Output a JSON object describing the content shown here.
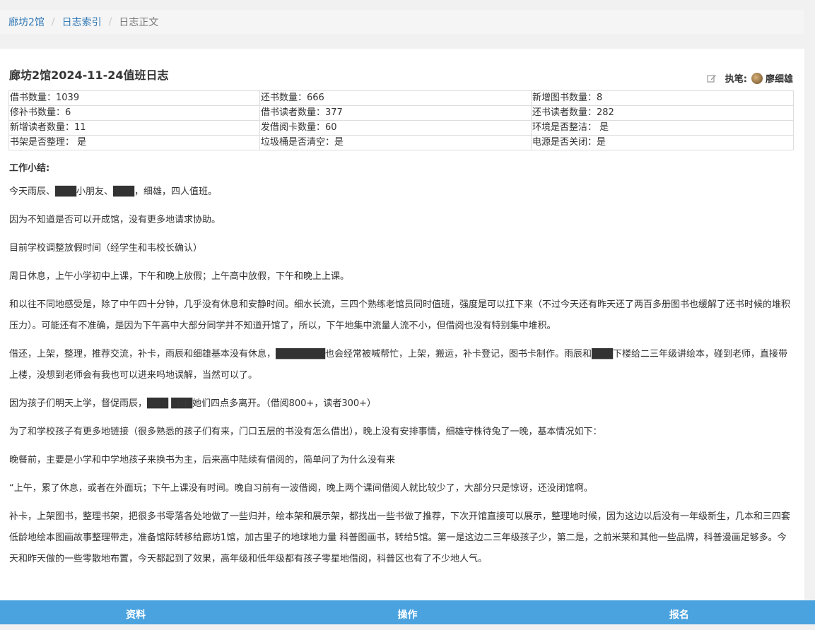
{
  "breadcrumb": {
    "items": [
      "廊坊2馆",
      "日志索引"
    ],
    "active": "日志正文"
  },
  "log": {
    "title": "廊坊2馆2024-11-24值班日志",
    "author_label": "执笔:",
    "author_name": "廖细雄"
  },
  "stats": [
    [
      "借书数量：1039",
      "还书数量：666",
      "新增图书数量：8"
    ],
    [
      "修补书数量：6",
      "借书读者数量：377",
      "还书读者数量：282"
    ],
    [
      "新增读者数量：11",
      "发借阅卡数量：60",
      "环境是否整洁： 是"
    ],
    [
      "书架是否整理： 是",
      "垃圾桶是否清空：是",
      "电源是否关闭：是"
    ]
  ],
  "summary_heading": "工作小结:",
  "paragraphs": [
    "今天雨辰、███小朋友、███，细雄，四人值班。",
    "因为不知道是否可以开成馆，没有更多地请求协助。",
    "目前学校调整放假时间（经学生和韦校长确认）",
    "周日休息，上午小学初中上课，下午和晚上放假；上午高中放假，下午和晚上上课。",
    "和以往不同地感受是，除了中午四十分钟，几乎没有休息和安静时间。细水长流，三四个熟练老馆员同时值班，强度是可以扛下来（不过今天还有昨天还了两百多册图书也缓解了还书时候的堆积压力）。可能还有不准确，是因为下午高中大部分同学并不知道开馆了，所以，下午地集中流量人流不小，但借阅也没有特别集中堆积。",
    "借还，上架，整理，推荐交流，补卡，雨辰和细雄基本没有休息，███████也会经常被喊帮忙，上架，搬运，补卡登记，图书卡制作。雨辰和███下楼给二三年级讲绘本，碰到老师，直接带上楼，没想到老师会有我也可以进来吗地误解，当然可以了。",
    "因为孩子们明天上学，督促雨辰，███ ███她们四点多离开。（借阅800+，读者300+）",
    "为了和学校孩子有更多地链接（很多熟悉的孩子们有来，门口五层的书没有怎么借出），晚上没有安排事情，细雄守株待兔了一晚，基本情况如下：",
    "晚餐前，主要是小学和中学地孩子来换书为主，后来高中陆续有借阅的，简单问了为什么没有来",
    "“上午，累了休息，或者在外面玩；下午上课没有时间。晚自习前有一波借阅，晚上两个课间借阅人就比较少了，大部分只是惊讶，还没闭馆啊。",
    "补卡，上架图书，整理书架，把很多书零落各处地做了一些归并，绘本架和展示架，都找出一些书做了推荐，下次开馆直接可以展示，整理地时候，因为这边以后没有一年级新生，几本和三四套低龄地绘本图画故事整理带走，准备馆际转移给廊坊1馆，加古里子的地球地力量 科普图画书，转给5馆。第一是这边二三年级孩子少，第二是，之前米莱和其他一些品牌，科普漫画足够多。今天和昨天做的一些零散地布置，今天都起到了效果，高年级和低年级都有孩子零星地借阅，科普区也有了不少地人气。"
  ],
  "bottom_nav": [
    "资料",
    "操作",
    "报名"
  ]
}
